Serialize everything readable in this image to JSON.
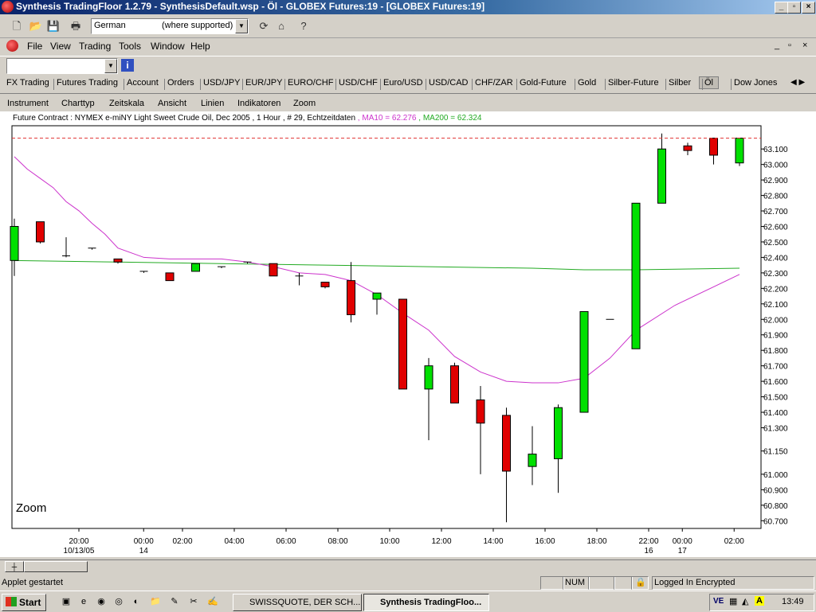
{
  "window": {
    "title": "Synthesis TradingFloor 1.2.79 - SynthesisDefault.wsp - Öl - GLOBEX Futures:19 - [GLOBEX Futures:19]",
    "min_label": "_",
    "max_label": "▫",
    "close_label": "X"
  },
  "toolbar": {
    "language_value": "German",
    "language_note": "(where supported)"
  },
  "menu": {
    "items": [
      "File",
      "View",
      "Trading",
      "Tools",
      "Window",
      "Help"
    ]
  },
  "tabs": [
    "FX Trading",
    "Futures Trading",
    "Account",
    "Orders",
    "USD/JPY",
    "EUR/JPY",
    "EURO/CHF",
    "USD/CHF",
    "Euro/USD",
    "USD/CAD",
    "CHF/ZAR",
    "Gold-Future",
    "Gold",
    "Silber-Future",
    "Silber",
    "Öl",
    "Dow Jones"
  ],
  "active_tab": "Öl",
  "chart_menu": [
    "Instrument",
    "Charttyp",
    "Zeitskala",
    "Ansicht",
    "Linien",
    "Indikatoren",
    "Zoom"
  ],
  "chart_info": {
    "contract": "Future Contract : NYMEX e-miNY Light Sweet Crude Oil, Dec 2005 , 1 Hour , # 29, Echtzeitdaten",
    "ma10_label": "MA10 = 62.276",
    "ma200_label": "MA200 = 62.324"
  },
  "zoom_label": "Zoom",
  "chart_data": {
    "type": "candlestick",
    "ylim": [
      60.65,
      63.25
    ],
    "y_ticks": [
      63.1,
      63.0,
      62.9,
      62.8,
      62.7,
      62.6,
      62.5,
      62.4,
      62.3,
      62.2,
      62.1,
      62.0,
      61.9,
      61.8,
      61.7,
      61.6,
      61.5,
      61.4,
      61.3,
      61.15,
      61.0,
      60.9,
      60.8,
      60.7
    ],
    "y_tick_labels": [
      "63.100",
      "63.000",
      "62.900",
      "62.800",
      "62.700",
      "62.600",
      "62.500",
      "62.400",
      "62.300",
      "62.200",
      "62.100",
      "62.000",
      "61.900",
      "61.800",
      "61.700",
      "61.600",
      "61.500",
      "61.400",
      "61.300",
      "61.150",
      "61.000",
      "60.900",
      "60.800",
      "60.700"
    ],
    "x_ticks": [
      {
        "index": 2,
        "label": "20:00",
        "sub": "10/13/05"
      },
      {
        "index": 4.5,
        "label": "00:00",
        "sub": "14"
      },
      {
        "index": 6,
        "label": "02:00",
        "sub": ""
      },
      {
        "index": 8,
        "label": "04:00",
        "sub": ""
      },
      {
        "index": 10,
        "label": "06:00",
        "sub": ""
      },
      {
        "index": 12,
        "label": "08:00",
        "sub": ""
      },
      {
        "index": 14,
        "label": "10:00",
        "sub": ""
      },
      {
        "index": 16,
        "label": "12:00",
        "sub": ""
      },
      {
        "index": 18,
        "label": "14:00",
        "sub": ""
      },
      {
        "index": 20,
        "label": "16:00",
        "sub": ""
      },
      {
        "index": 22,
        "label": "18:00",
        "sub": ""
      },
      {
        "index": 24,
        "label": "22:00",
        "sub": "16"
      },
      {
        "index": 25.3,
        "label": "00:00",
        "sub": "17"
      },
      {
        "index": 27.3,
        "label": "02:00",
        "sub": ""
      }
    ],
    "candles": [
      {
        "o": 62.38,
        "h": 62.65,
        "l": 62.28,
        "c": 62.6
      },
      {
        "o": 62.63,
        "h": 62.63,
        "l": 62.49,
        "c": 62.5
      },
      {
        "o": 62.41,
        "h": 62.53,
        "l": 62.4,
        "c": 62.41
      },
      {
        "o": 62.46,
        "h": 62.46,
        "l": 62.45,
        "c": 62.46
      },
      {
        "o": 62.39,
        "h": 62.39,
        "l": 62.36,
        "c": 62.37
      },
      {
        "o": 62.31,
        "h": 62.31,
        "l": 62.3,
        "c": 62.31
      },
      {
        "o": 62.3,
        "h": 62.3,
        "l": 62.25,
        "c": 62.25
      },
      {
        "o": 62.31,
        "h": 62.36,
        "l": 62.31,
        "c": 62.36
      },
      {
        "o": 62.34,
        "h": 62.34,
        "l": 62.33,
        "c": 62.34
      },
      {
        "o": 62.37,
        "h": 62.37,
        "l": 62.36,
        "c": 62.37
      },
      {
        "o": 62.36,
        "h": 62.36,
        "l": 62.28,
        "c": 62.28
      },
      {
        "o": 62.28,
        "h": 62.3,
        "l": 62.22,
        "c": 62.28
      },
      {
        "o": 62.24,
        "h": 62.24,
        "l": 62.2,
        "c": 62.21
      },
      {
        "o": 62.25,
        "h": 62.37,
        "l": 61.98,
        "c": 62.03
      },
      {
        "o": 62.13,
        "h": 62.17,
        "l": 62.03,
        "c": 62.17
      },
      {
        "o": 62.13,
        "h": 62.13,
        "l": 61.55,
        "c": 61.55
      },
      {
        "o": 61.55,
        "h": 61.75,
        "l": 61.22,
        "c": 61.7
      },
      {
        "o": 61.7,
        "h": 61.72,
        "l": 61.46,
        "c": 61.46
      },
      {
        "o": 61.48,
        "h": 61.57,
        "l": 61.0,
        "c": 61.33
      },
      {
        "o": 61.38,
        "h": 61.43,
        "l": 60.69,
        "c": 61.02
      },
      {
        "o": 61.05,
        "h": 61.31,
        "l": 60.93,
        "c": 61.13
      },
      {
        "o": 61.1,
        "h": 61.45,
        "l": 60.88,
        "c": 61.43
      },
      {
        "o": 61.4,
        "h": 62.05,
        "l": 61.4,
        "c": 62.05
      },
      {
        "o": 62.0,
        "h": 62.0,
        "l": 62.0,
        "c": 62.0
      },
      {
        "o": 61.81,
        "h": 62.75,
        "l": 61.81,
        "c": 62.75
      },
      {
        "o": 62.75,
        "h": 63.2,
        "l": 62.75,
        "c": 63.1
      },
      {
        "o": 63.12,
        "h": 63.14,
        "l": 63.06,
        "c": 63.09
      },
      {
        "o": 63.17,
        "h": 63.17,
        "l": 63.0,
        "c": 63.06
      },
      {
        "o": 63.01,
        "h": 63.17,
        "l": 62.99,
        "c": 63.17
      }
    ],
    "ma10": [
      63.05,
      62.97,
      62.91,
      62.85,
      62.76,
      62.7,
      62.62,
      62.55,
      62.46,
      62.4,
      62.39,
      62.39,
      62.39,
      62.37,
      62.34,
      62.3,
      62.29,
      62.25,
      62.16,
      62.04,
      61.93,
      61.76,
      61.66,
      61.6,
      61.59,
      61.59,
      61.62,
      61.75,
      61.93,
      62.09,
      62.29
    ],
    "ma10_x": [
      0,
      0.5,
      1,
      1.5,
      2,
      2.5,
      3,
      3.5,
      4,
      5,
      6,
      7,
      8,
      9,
      10,
      11,
      12,
      13,
      14,
      15,
      16,
      17,
      18,
      19,
      20,
      21,
      22,
      23,
      24,
      25.5,
      28
    ],
    "ma200": [
      62.38,
      62.37,
      62.36,
      62.35,
      62.34,
      62.33,
      62.32,
      62.32,
      62.33
    ],
    "ma200_x": [
      0,
      4,
      8,
      12,
      16,
      20,
      22,
      24,
      28
    ],
    "resistance": 63.17,
    "colors": {
      "up": "#00e000",
      "down": "#e00000",
      "ma10": "#cc33cc",
      "ma200": "#22aa22",
      "resistance": "#e03030"
    }
  },
  "status": {
    "left": "Applet gestartet",
    "num": "NUM",
    "security": "Logged In Encrypted"
  },
  "taskbar": {
    "start": "Start",
    "task1": "SWISSQUOTE, DER SCH...",
    "task2": "Synthesis TradingFloo...",
    "clock": "13:49"
  }
}
